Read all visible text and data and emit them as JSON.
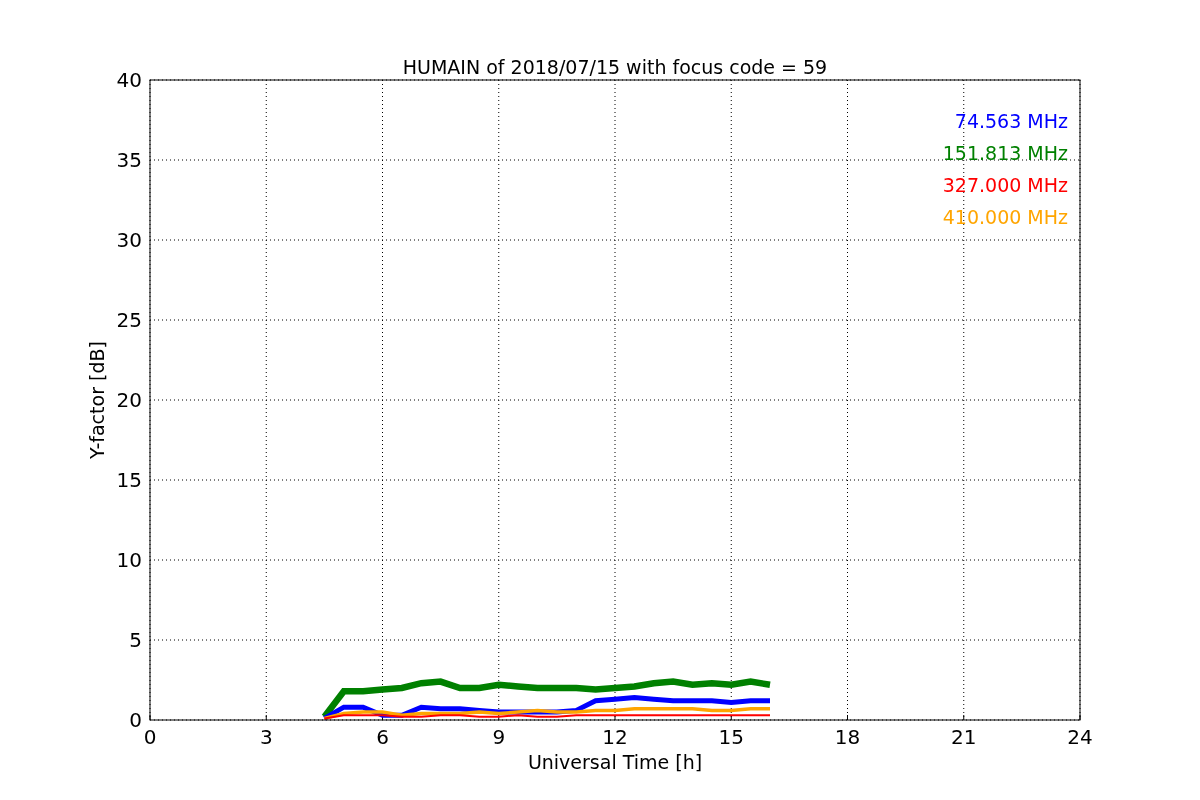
{
  "chart": {
    "chart_data": {
      "type": "line",
      "title": "HUMAIN of 2018/07/15 with focus code = 59",
      "xlabel": "Universal Time [h]",
      "ylabel": "Y-factor [dB]",
      "x": [
        4.5,
        5,
        5.5,
        6,
        6.5,
        7,
        7.5,
        8,
        8.5,
        9,
        9.5,
        10,
        10.5,
        11,
        11.5,
        12,
        12.5,
        13,
        13.5,
        14,
        14.5,
        15,
        15.5,
        16
      ],
      "series": [
        {
          "name": "74.563 MHz",
          "color": "#0000ff",
          "values": [
            0.1,
            0.8,
            0.8,
            0.3,
            0.3,
            0.8,
            0.7,
            0.7,
            0.6,
            0.5,
            0.5,
            0.5,
            0.5,
            0.6,
            1.2,
            1.3,
            1.4,
            1.3,
            1.2,
            1.2,
            1.2,
            1.1,
            1.2,
            1.2
          ]
        },
        {
          "name": "151.813 MHz",
          "color": "#008000",
          "values": [
            0.2,
            1.8,
            1.8,
            1.9,
            2.0,
            2.3,
            2.4,
            2.0,
            2.0,
            2.2,
            2.1,
            2.0,
            2.0,
            2.0,
            1.9,
            2.0,
            2.1,
            2.3,
            2.4,
            2.2,
            2.3,
            2.2,
            2.4,
            2.2
          ]
        },
        {
          "name": "327.000 MHz",
          "color": "#ff0000",
          "values": [
            0.1,
            0.3,
            0.3,
            0.3,
            0.2,
            0.2,
            0.3,
            0.3,
            0.2,
            0.2,
            0.3,
            0.2,
            0.2,
            0.3,
            0.3,
            0.3,
            0.3,
            0.3,
            0.3,
            0.3,
            0.3,
            0.3,
            0.3,
            0.3
          ]
        },
        {
          "name": "410.000 MHz",
          "color": "#ffa500",
          "values": [
            0.1,
            0.4,
            0.5,
            0.5,
            0.3,
            0.4,
            0.4,
            0.4,
            0.5,
            0.4,
            0.5,
            0.6,
            0.5,
            0.5,
            0.6,
            0.6,
            0.7,
            0.7,
            0.7,
            0.7,
            0.6,
            0.6,
            0.7,
            0.7
          ]
        }
      ],
      "grid": true,
      "xlim": [
        0,
        24
      ],
      "ylim": [
        0,
        40
      ],
      "xticks": [
        0,
        3,
        6,
        9,
        12,
        15,
        18,
        21,
        24
      ],
      "yticks": [
        0,
        5,
        10,
        15,
        20,
        25,
        30,
        35,
        40
      ]
    }
  }
}
